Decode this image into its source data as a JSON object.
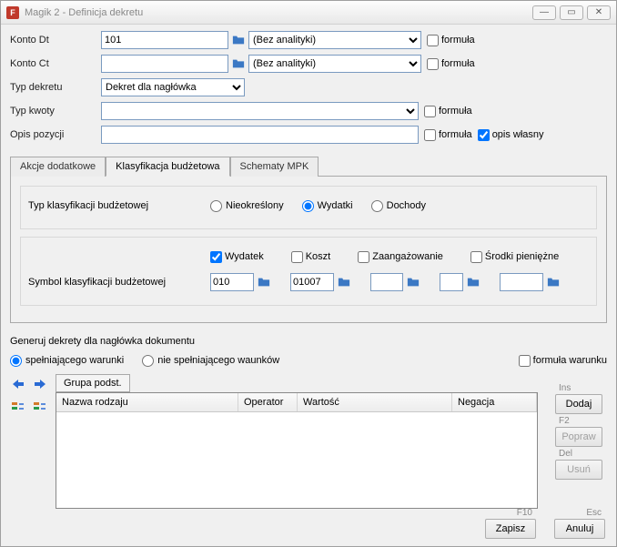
{
  "window": {
    "title": "Magik 2  - Definicja dekretu"
  },
  "labels": {
    "konto_dt": "Konto Dt",
    "konto_ct": "Konto Ct",
    "typ_dekretu": "Typ dekretu",
    "typ_kwoty": "Typ kwoty",
    "opis_pozycji": "Opis pozycji",
    "formula": "formuła",
    "opis_wlasny": "opis własny"
  },
  "fields": {
    "konto_dt": "101",
    "konto_ct": "",
    "analityka_dt": "(Bez analityki)",
    "analityka_ct": "(Bez analityki)",
    "typ_dekretu": "Dekret dla nagłówka",
    "typ_kwoty": "",
    "opis_pozycji": ""
  },
  "checks": {
    "formula_dt": false,
    "formula_ct": false,
    "formula_kwoty": false,
    "formula_opis": false,
    "opis_wlasny": true
  },
  "tabs": {
    "t1": "Akcje dodatkowe",
    "t2": "Klasyfikacja budżetowa",
    "t3": "Schematy MPK",
    "active": 1
  },
  "klas": {
    "typ_label": "Typ klasyfikacji budżetowej",
    "radios": {
      "nieokr": "Nieokreślony",
      "wydatki": "Wydatki",
      "dochody": "Dochody",
      "selected": "wydatki"
    },
    "sym_label": "Symbol klasyfikacji budżetowej",
    "checks": {
      "wydatek": "Wydatek",
      "koszt": "Koszt",
      "zaang": "Zaangażowanie",
      "srodki": "Środki pieniężne",
      "wydatek_on": true
    },
    "inputs": {
      "c1": "010",
      "c2": "01007",
      "c3": "",
      "c4": "",
      "c5": ""
    }
  },
  "gen": {
    "title": "Generuj dekrety dla nagłówka dokumentu",
    "r1": "spełniającego warunki",
    "r2": "nie spełniającego waunków",
    "selected": "r1",
    "formula_warunku": "formuła warunku",
    "formula_warunku_on": false
  },
  "subtab": "Grupa podst.",
  "grid": {
    "h1": "Nazwa rodzaju",
    "h2": "Operator",
    "h3": "Wartość",
    "h4": "Negacja"
  },
  "side": {
    "ins": "Ins",
    "dodaj": "Dodaj",
    "f2": "F2",
    "popraw": "Popraw",
    "del": "Del",
    "usun": "Usuń"
  },
  "footer": {
    "f10": "F10",
    "zapisz": "Zapisz",
    "esc": "Esc",
    "anuluj": "Anuluj"
  }
}
